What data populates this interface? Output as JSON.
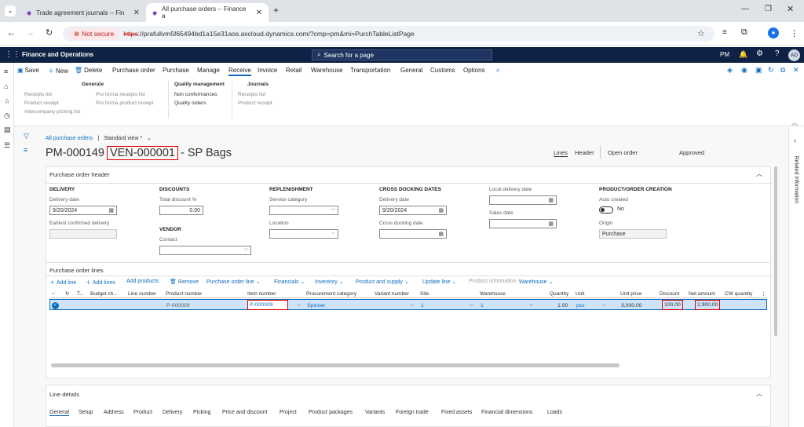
{
  "browser": {
    "tabs": [
      {
        "title": "Trade agreement journals -- Fin",
        "active": false
      },
      {
        "title": "All purchase orders -- Finance a",
        "active": true
      }
    ],
    "not_secure": "Not secure",
    "url_scheme": "https",
    "url_rest": "://prafullvm5f65494bd1a15e31aos.axcloud.dynamics.com/?cmp=pm&mi=PurchTableListPage"
  },
  "app": {
    "title": "Finance and Operations",
    "search_placeholder": "Search for a page",
    "company": "PM",
    "user_initials": "AD"
  },
  "action_pane": {
    "items": [
      "Save",
      "New",
      "Delete",
      "Purchase order",
      "Purchase",
      "Manage",
      "Receive",
      "Invoice",
      "Retail",
      "Warehouse",
      "Transportation",
      "General",
      "Customs",
      "Options"
    ],
    "active_tab": "Receive",
    "groups": {
      "generate": {
        "title": "Generate",
        "col1": [
          "Receipts list",
          "Product receipt",
          "Intercompany picking list"
        ],
        "col2": [
          "Pro forma receipts list",
          "Pro forma product receipt"
        ]
      },
      "quality": {
        "title": "Quality management",
        "items": [
          "Non conformances",
          "Quality orders"
        ]
      },
      "journals": {
        "title": "Journals",
        "items": [
          "Receipts list",
          "Product receipt"
        ]
      }
    }
  },
  "page": {
    "breadcrumb": "All purchase orders",
    "view": "Standard view *",
    "po_number": "PM-000149",
    "vendor": "VEN-000001",
    "vendor_name": "- SP Bags",
    "header_tabs": [
      "Lines",
      "Header"
    ],
    "status_open": "Open order",
    "status_approved": "Approved"
  },
  "po_header": {
    "title": "Purchase order header",
    "delivery": {
      "head": "DELIVERY",
      "date_label": "Delivery date",
      "date": "9/20/2024",
      "confirmed_label": "Earliest confirmed delivery"
    },
    "discounts": {
      "head": "DISCOUNTS",
      "label": "Total discount %",
      "value": "0.00"
    },
    "vendor": {
      "head": "VENDOR",
      "contact_label": "Contact"
    },
    "replenishment": {
      "head": "REPLENISHMENT",
      "service_label": "Service category",
      "location_label": "Location"
    },
    "cross_docking": {
      "head": "CROSS DOCKING DATES",
      "delivery_label": "Delivery date",
      "delivery_value": "9/20/2024",
      "cross_label": "Cross docking date"
    },
    "local": {
      "local_label": "Local delivery date",
      "sales_label": "Sales date"
    },
    "creation": {
      "head": "PRODUCT/ORDER CREATION",
      "auto_label": "Auto created",
      "auto_value": "No",
      "origin_label": "Origin",
      "origin_value": "Purchase"
    }
  },
  "po_lines": {
    "title": "Purchase order lines",
    "toolbar": [
      "Add line",
      "Add lines",
      "Add products",
      "Remove",
      "Purchase order line",
      "Financials",
      "Inventory",
      "Product and supply",
      "Update line",
      "Product information",
      "Warehouse"
    ],
    "columns": [
      "T...",
      "Budget ch...",
      "Line number",
      "Product number",
      "Item number",
      "Procurement category",
      "Variant number",
      "Site",
      "Warehouse",
      "Quantity",
      "Unit",
      "Unit price",
      "Discount",
      "Net amount",
      "CW quantity"
    ],
    "row": {
      "product_number": "P-000009",
      "item_number": "P-000009",
      "procurement_category": "Spinner",
      "site": "1",
      "warehouse": "1",
      "quantity": "1.00",
      "unit": "pcs",
      "unit_price": "3,000.00",
      "discount": "100.00",
      "net_amount": "2,900.00"
    }
  },
  "line_details": {
    "title": "Line details",
    "tabs": [
      "General",
      "Setup",
      "Address",
      "Product",
      "Delivery",
      "Picking",
      "Price and discount",
      "Project",
      "Product packages",
      "Variants",
      "Foreign trade",
      "Fixed assets",
      "Financial dimensions",
      "Loads"
    ]
  },
  "right_pane": {
    "label": "Related information"
  },
  "colors": {
    "nav": "#0f2245",
    "accent": "#0f6cbd",
    "highlight": "#e00000",
    "row_selected": "#cfe4fa"
  }
}
